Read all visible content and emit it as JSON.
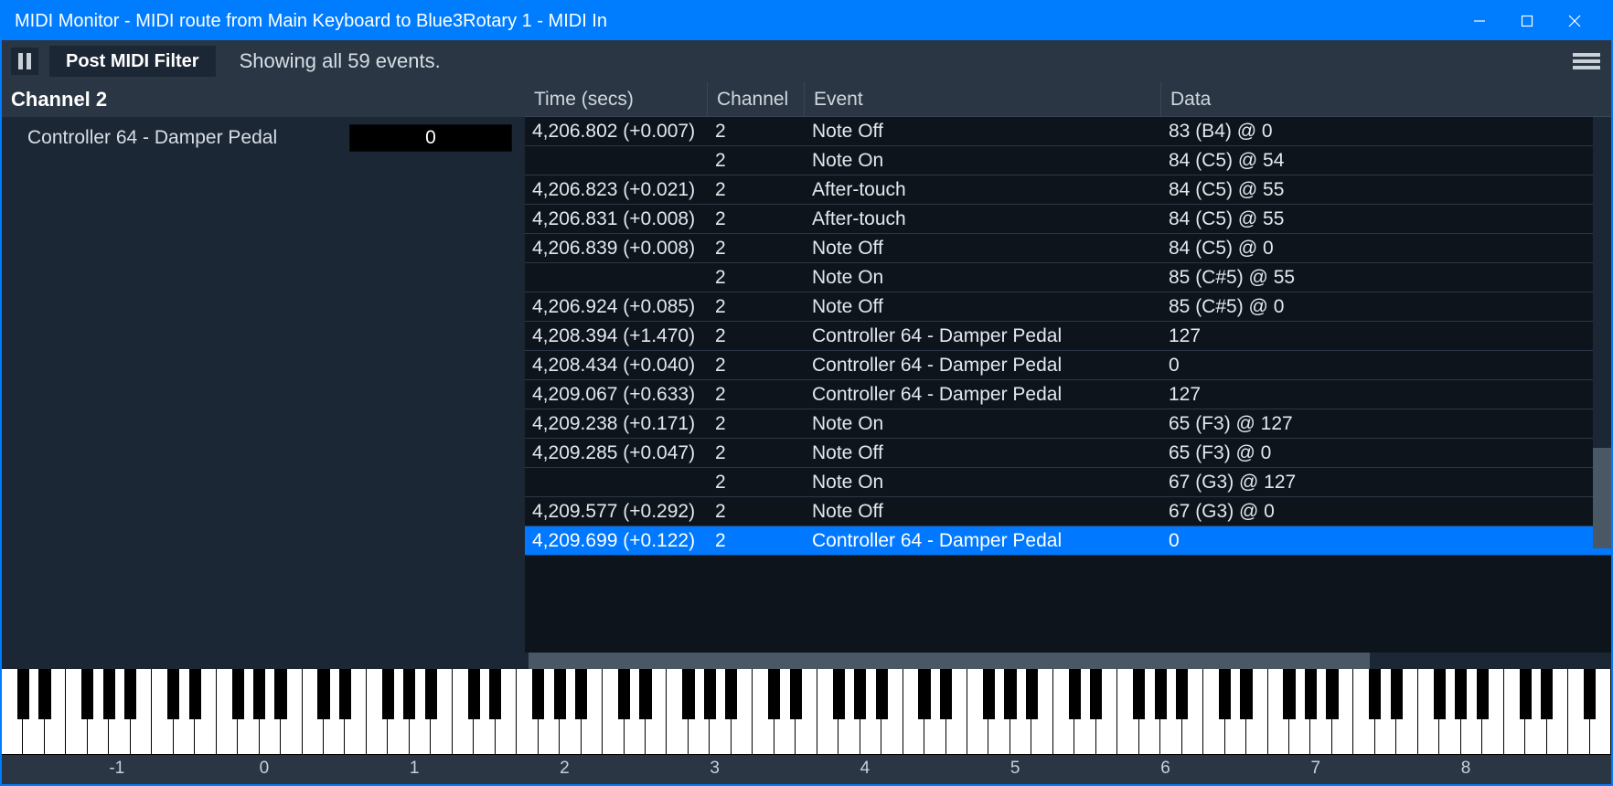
{
  "window": {
    "title": "MIDI Monitor - MIDI route from Main Keyboard to Blue3Rotary 1 - MIDI In"
  },
  "toolbar": {
    "filter_button": "Post MIDI Filter",
    "status": "Showing all 59 events."
  },
  "left_panel": {
    "channel_header": "Channel 2",
    "controller_label": "Controller 64 - Damper Pedal",
    "controller_value": "0"
  },
  "table": {
    "headers": {
      "time": "Time (secs)",
      "channel": "Channel",
      "event": "Event",
      "data": "Data"
    },
    "rows": [
      {
        "time": "4,206.802 (+0.007)",
        "channel": "2",
        "event": "Note Off",
        "data": "83 (B4) @ 0",
        "selected": false
      },
      {
        "time": "",
        "channel": "2",
        "event": "Note On",
        "data": "84 (C5) @ 54",
        "selected": false
      },
      {
        "time": "4,206.823 (+0.021)",
        "channel": "2",
        "event": "After-touch",
        "data": "84 (C5) @ 55",
        "selected": false
      },
      {
        "time": "4,206.831 (+0.008)",
        "channel": "2",
        "event": "After-touch",
        "data": "84 (C5) @ 55",
        "selected": false
      },
      {
        "time": "4,206.839 (+0.008)",
        "channel": "2",
        "event": "Note Off",
        "data": "84 (C5) @ 0",
        "selected": false
      },
      {
        "time": "",
        "channel": "2",
        "event": "Note On",
        "data": "85 (C#5) @ 55",
        "selected": false
      },
      {
        "time": "4,206.924 (+0.085)",
        "channel": "2",
        "event": "Note Off",
        "data": "85 (C#5) @ 0",
        "selected": false
      },
      {
        "time": "4,208.394 (+1.470)",
        "channel": "2",
        "event": "Controller 64 - Damper Pedal",
        "data": "127",
        "selected": false
      },
      {
        "time": "4,208.434 (+0.040)",
        "channel": "2",
        "event": "Controller 64 - Damper Pedal",
        "data": "0",
        "selected": false
      },
      {
        "time": "4,209.067 (+0.633)",
        "channel": "2",
        "event": "Controller 64 - Damper Pedal",
        "data": "127",
        "selected": false
      },
      {
        "time": "4,209.238 (+0.171)",
        "channel": "2",
        "event": "Note On",
        "data": "65 (F3) @ 127",
        "selected": false
      },
      {
        "time": "4,209.285 (+0.047)",
        "channel": "2",
        "event": "Note Off",
        "data": "65 (F3) @ 0",
        "selected": false
      },
      {
        "time": "",
        "channel": "2",
        "event": "Note On",
        "data": "67 (G3) @ 127",
        "selected": false
      },
      {
        "time": "4,209.577 (+0.292)",
        "channel": "2",
        "event": "Note Off",
        "data": "67 (G3) @ 0",
        "selected": false
      },
      {
        "time": "4,209.699 (+0.122)",
        "channel": "2",
        "event": "Controller 64 - Damper Pedal",
        "data": "0",
        "selected": true
      }
    ]
  },
  "piano": {
    "octave_labels": [
      "-1",
      "0",
      "1",
      "2",
      "3",
      "4",
      "5",
      "6",
      "7",
      "8"
    ]
  }
}
